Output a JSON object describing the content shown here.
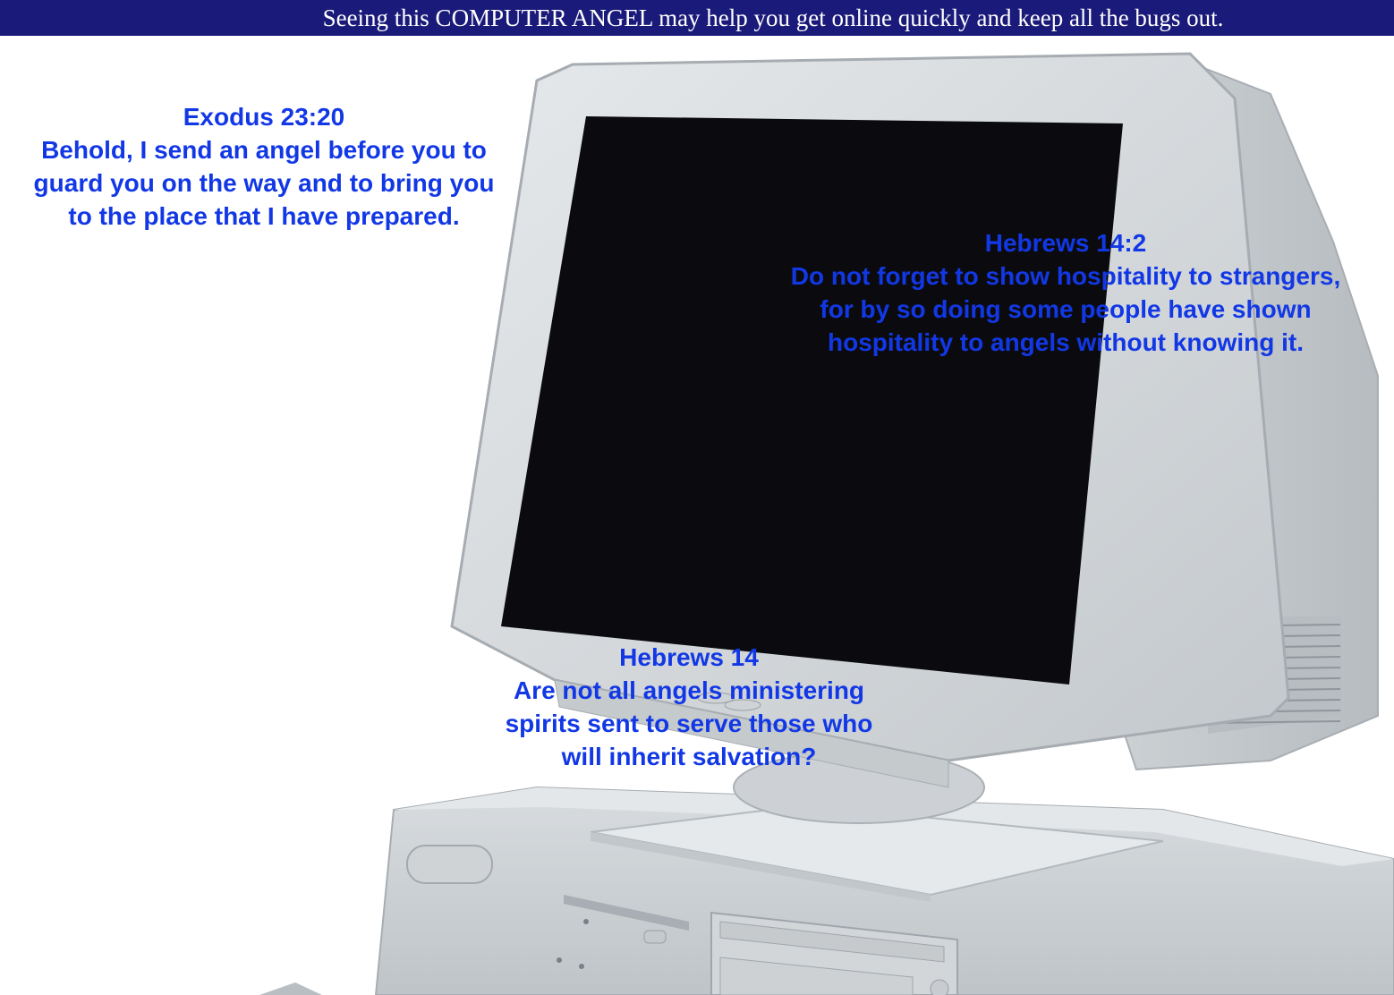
{
  "banner": {
    "text": "Seeing this COMPUTER ANGEL may help you get online quickly and keep all the bugs out."
  },
  "verses": [
    {
      "reference": "Exodus 23:20",
      "lines": [
        "Behold, I send an angel before you to",
        "guard you on the way and to bring you",
        "to the place that I have prepared."
      ]
    },
    {
      "reference": "Hebrews 14:2",
      "lines": [
        "Do not forget to show hospitality to strangers,",
        "for by so doing some people have shown",
        "hospitality to angels without knowing it."
      ]
    },
    {
      "reference": "Hebrews 14",
      "lines": [
        "Are not all angels ministering",
        "spirits sent to serve those who",
        "will inherit salvation?"
      ]
    }
  ],
  "colors": {
    "banner_background": "#1a1a7a",
    "banner_text": "#ffffff",
    "verse_text": "#1238e6",
    "screen": "#0b0b0f",
    "computer_body": "#d4d8db"
  },
  "image": {
    "subject": "computer-monitor-and-desktop-tower-icon"
  }
}
